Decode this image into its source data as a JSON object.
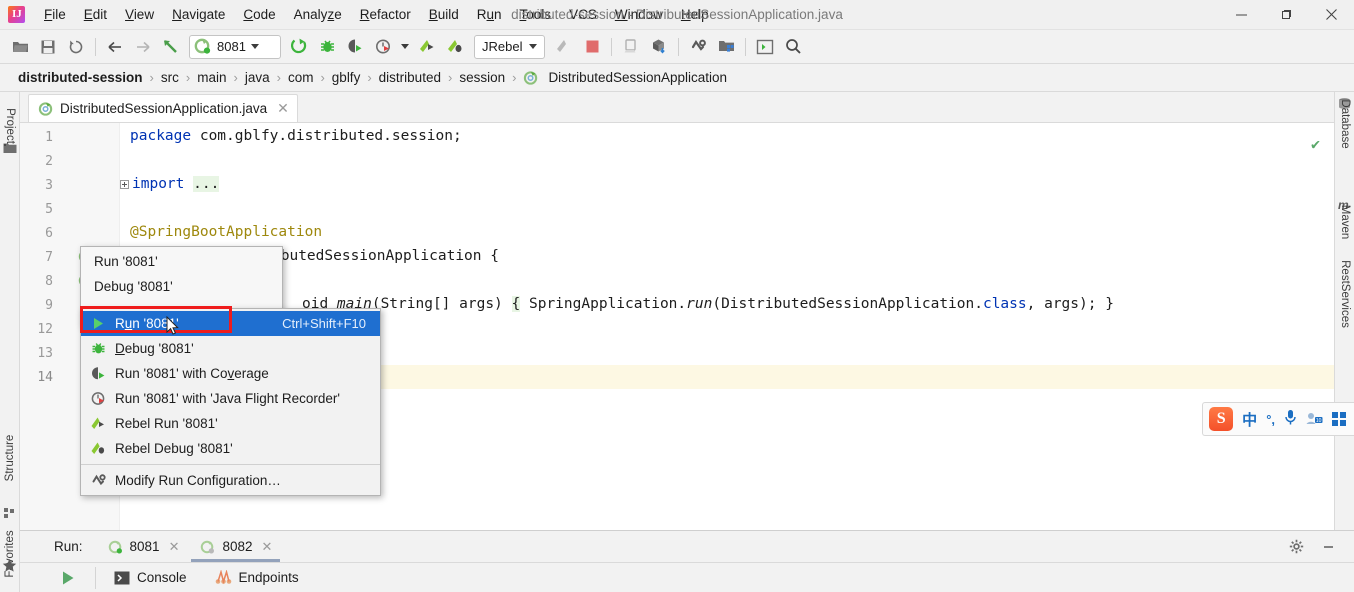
{
  "titlebar": {
    "app_icon": "intellij-logo",
    "window_title": "distributed-session - DistributedSessionApplication.java",
    "menus": [
      {
        "label": "File",
        "mnemonic": "F"
      },
      {
        "label": "Edit",
        "mnemonic": "E"
      },
      {
        "label": "View",
        "mnemonic": "V"
      },
      {
        "label": "Navigate",
        "mnemonic": "N"
      },
      {
        "label": "Code",
        "mnemonic": "C"
      },
      {
        "label": "Analyze",
        "mnemonic": "z"
      },
      {
        "label": "Refactor",
        "mnemonic": "R"
      },
      {
        "label": "Build",
        "mnemonic": "B"
      },
      {
        "label": "Run",
        "mnemonic": "u"
      },
      {
        "label": "Tools",
        "mnemonic": "T"
      },
      {
        "label": "VCS",
        "mnemonic": ""
      },
      {
        "label": "Window",
        "mnemonic": "W"
      },
      {
        "label": "Help",
        "mnemonic": "H"
      }
    ],
    "minimize": "—",
    "maximize": "❐",
    "close": "✕"
  },
  "toolbar": {
    "open_label": "open-project",
    "save_label": "save-all",
    "sync_label": "synchronize",
    "back_label": "back",
    "forward_label": "forward",
    "update_label": "update-project",
    "run_config_name": "8081",
    "run_label": "Run",
    "debug_label": "Debug",
    "coverage_label": "Run with Coverage",
    "profiler_label": "Profile",
    "rebel_run_label": "Rebel Run",
    "rebel_debug_label": "Rebel Debug",
    "jrebel_name": "JRebel",
    "stop_label": "Stop",
    "device_label": "device-manager",
    "sdk_label": "sdk-download",
    "settings_label": "Settings",
    "project_structure_label": "Project Structure",
    "terminal_label": "Terminal",
    "search_label": "Search Everywhere"
  },
  "breadcrumb": {
    "separator": "›",
    "items": [
      "distributed-session",
      "src",
      "main",
      "java",
      "com",
      "gblfy",
      "distributed",
      "session",
      "DistributedSessionApplication"
    ]
  },
  "editor": {
    "tab_name": "DistributedSessionApplication.java",
    "tab_close": "✕",
    "inspection_status": "✔",
    "lines": [
      {
        "num": "1",
        "text": "package com.gblfy.distributed.session;"
      },
      {
        "num": "2",
        "text": ""
      },
      {
        "num": "3",
        "text": "import ..."
      },
      {
        "num": "5",
        "text": ""
      },
      {
        "num": "6",
        "text": "@SpringBootApplication"
      },
      {
        "num": "7",
        "text": "public class DistributedSessionApplication {"
      },
      {
        "num": "8",
        "text": ""
      },
      {
        "num": "9",
        "text": "public static void main(String[] args) { SpringApplication.run(DistributedSessionApplication.class, args); }"
      },
      {
        "num": "12",
        "text": ""
      },
      {
        "num": "13",
        "text": ""
      },
      {
        "num": "14",
        "text": ""
      }
    ],
    "code": {
      "l1_kw": "package",
      "l1_rest": " com.gblfy.distributed.session;",
      "l3_kw": "import",
      "l3_dots": "...",
      "l6_annotation": "@SpringBootApplication",
      "l7_visible": "ibutedSessionApplication {",
      "l9_pre": "oid ",
      "l9_main": "main",
      "l9_sig": "(String[] args) ",
      "l9_brace_open": "{",
      "l9_body": " SpringApplication.",
      "l9_run": "run",
      "l9_args": "(DistributedSessionApplication.",
      "l9_class": "class",
      "l9_tail": ", args); ",
      "l9_brace_close": "}"
    }
  },
  "context_menu_background": {
    "items": [
      {
        "label": "Run '8081'"
      },
      {
        "label": "Debug '8081'"
      },
      {
        "label": "Run '8081' with Coverage"
      }
    ]
  },
  "context_menu": {
    "items": [
      {
        "label": "Run '8081'",
        "mnemonic_pre": "R",
        "mnemonic": "u",
        "mnemonic_post": "n '8081'",
        "shortcut": "Ctrl+Shift+F10",
        "icon": "run-green-triangle-icon",
        "selected": true
      },
      {
        "label": "Debug '8081'",
        "mnemonic_pre": "",
        "mnemonic": "D",
        "mnemonic_post": "ebug '8081'",
        "shortcut": "",
        "icon": "debug-bug-icon",
        "selected": false
      },
      {
        "label": "Run '8081' with Coverage",
        "mnemonic_pre": "Run '8081' with Co",
        "mnemonic": "v",
        "mnemonic_post": "erage",
        "shortcut": "",
        "icon": "coverage-icon",
        "selected": false
      },
      {
        "label": "Run '8081' with 'Java Flight Recorder'",
        "mnemonic_pre": "Run '8081' with 'Java Flight Recorder'",
        "mnemonic": "",
        "mnemonic_post": "",
        "shortcut": "",
        "icon": "flight-recorder-icon",
        "selected": false
      },
      {
        "label": "Rebel Run '8081'",
        "mnemonic_pre": "Rebel Run '8081'",
        "mnemonic": "",
        "mnemonic_post": "",
        "shortcut": "",
        "icon": "rebel-run-icon",
        "selected": false
      },
      {
        "label": "Rebel Debug '8081'",
        "mnemonic_pre": "Rebel Debug '8081'",
        "mnemonic": "",
        "mnemonic_post": "",
        "shortcut": "",
        "icon": "rebel-debug-icon",
        "selected": false
      }
    ],
    "modify_item": {
      "label": "Modify Run Configuration…",
      "icon": "wrench-icon"
    },
    "highlight_color": "#ef1c1c",
    "selection_color": "#1f6fd0"
  },
  "left_sidebar": {
    "items": [
      {
        "label": "Project",
        "icon": "project-folder-icon"
      },
      {
        "label": "Structure",
        "icon": "structure-icon"
      },
      {
        "label": "Favorites",
        "icon": "star-icon"
      }
    ]
  },
  "right_sidebar": {
    "items": [
      {
        "label": "Database",
        "icon": "database-icon"
      },
      {
        "label": "Maven",
        "icon": "maven-m-icon"
      },
      {
        "label": "RestServices",
        "icon": "rest-services-icon"
      }
    ]
  },
  "run_panel": {
    "title": "Run:",
    "tabs": [
      {
        "label": "8081",
        "close": "✕",
        "active": false,
        "icon": "spring-run-icon"
      },
      {
        "label": "8082",
        "close": "✕",
        "active": true,
        "icon": "spring-run-icon"
      }
    ],
    "settings_icon": "gear-icon",
    "minimize_icon": "—",
    "rerun_icon": "rerun-green-triangle-icon",
    "views": [
      {
        "label": "Console",
        "icon": "console-icon"
      },
      {
        "label": "Endpoints",
        "icon": "endpoints-icon"
      }
    ]
  },
  "ime_toolbar": {
    "brand": "S",
    "mode_label": "中",
    "punct_label": "°,",
    "mic_icon": "microphone-icon",
    "keyboard_icon": "soft-keyboard-icon",
    "menu_icon": "ime-menu-icon"
  },
  "colors": {
    "accent_blue": "#1f6fd0",
    "highlight_red": "#ef1c1c",
    "keyword_blue": "#0033b3",
    "green": "#59a869",
    "current_line": "#fdf8e3"
  }
}
